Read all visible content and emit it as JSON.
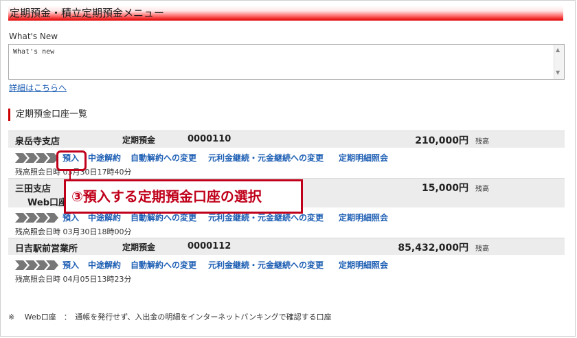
{
  "page": {
    "title": "定期預金・積立定期預金メニュー"
  },
  "whats_new": {
    "label": "What's New",
    "content": "What's new",
    "link": "詳細はこちらへ"
  },
  "section": {
    "heading": "定期預金口座一覧"
  },
  "accounts": [
    {
      "branch": "泉岳寺支店",
      "type": "定期預金",
      "number": "0000110",
      "balance": "210,000円",
      "balance_label": "残高",
      "subtype": "",
      "date": "残高照会日時 03月30日17時40分"
    },
    {
      "branch": "三田支店",
      "type": "",
      "number": "",
      "balance": "15,000円",
      "balance_label": "残高",
      "subtype": "Web口座",
      "date": "残高照会日時 03月30日18時00分"
    },
    {
      "branch": "日吉駅前営業所",
      "type": "定期預金",
      "number": "0000112",
      "balance": "85,432,000円",
      "balance_label": "残高",
      "subtype": "",
      "date": "残高照会日時 04月05日13時23分"
    }
  ],
  "actions": {
    "deposit": "預入",
    "cancel": "中途解約",
    "auto_change": "自動解約への変更",
    "continue_change": "元利金継続・元金継続への変更",
    "detail": "定期明細照会"
  },
  "footnote": "※　 Web口座　：　通帳を発行せず、入出金の明細をインターネットバンキングで確認する口座",
  "callout": {
    "text": "③預入する定期預金口座の選択"
  },
  "colors": {
    "accent": "#cc0000",
    "link": "#1e5fb4"
  }
}
